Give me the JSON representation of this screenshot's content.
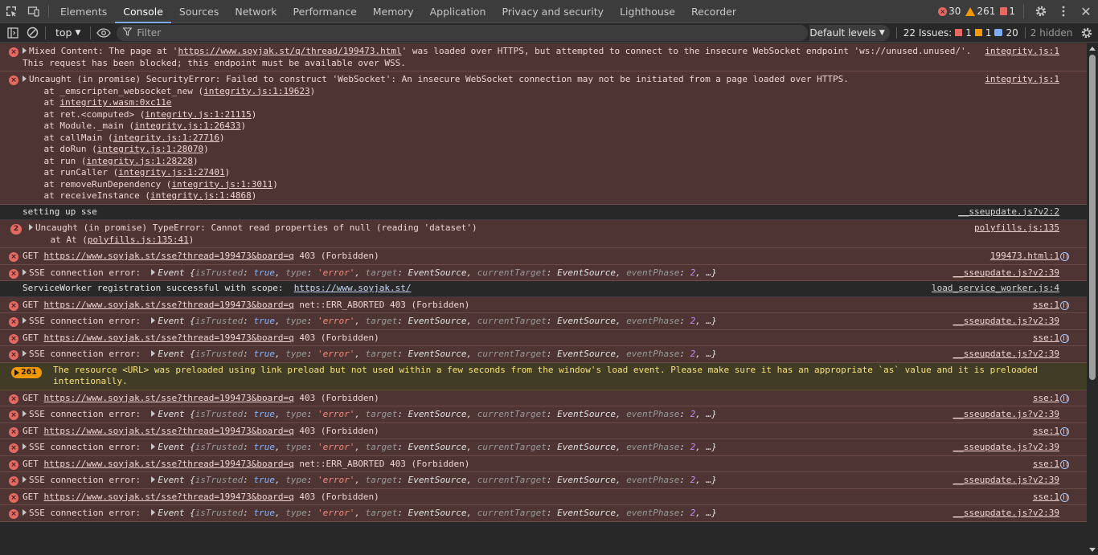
{
  "tabs": [
    "Elements",
    "Console",
    "Sources",
    "Network",
    "Performance",
    "Memory",
    "Application",
    "Privacy and security",
    "Lighthouse",
    "Recorder"
  ],
  "active_tab": "Console",
  "counts": {
    "errors": "30",
    "warnings": "261",
    "issues": "1"
  },
  "toolbar": {
    "context": "top",
    "filter_placeholder": "Filter",
    "levels": "Default levels",
    "issues_label": "22 Issues:",
    "issue_err": "1",
    "issue_warn": "1",
    "issue_info": "20",
    "hidden": "2 hidden"
  },
  "messages": [
    {
      "kind": "err",
      "ico": "x",
      "expand": true,
      "lines": [
        "Mixed Content: The page at 'https://www.soyjak.st/q/thread/199473.html' was loaded over HTTPS, but attempted to connect to the insecure WebSocket endpoint 'ws://unused.unused/'.",
        "This request has been blocked; this endpoint must be available over WSS."
      ],
      "src": "integrity.js:1"
    },
    {
      "kind": "err",
      "ico": "x",
      "expand": true,
      "lines": [
        "Uncaught (in promise) SecurityError: Failed to construct 'WebSocket': An insecure WebSocket connection may not be initiated from a page loaded over HTTPS.",
        "    at _emscripten_websocket_new (integrity.js:1:19623)",
        "    at integrity.wasm:0xc11e",
        "    at ret.<computed> (integrity.js:1:21115)",
        "    at Module._main (integrity.js:1:26433)",
        "    at callMain (integrity.js:1:27716)",
        "    at doRun (integrity.js:1:28070)",
        "    at run (integrity.js:1:28228)",
        "    at runCaller (integrity.js:1:27401)",
        "    at removeRunDependency (integrity.js:1:3011)",
        "    at receiveInstance (integrity.js:1:4868)"
      ],
      "src": "integrity.js:1"
    },
    {
      "kind": "info",
      "lines": [
        "setting up sse"
      ],
      "src": "__sseupdate.js?v2:2"
    },
    {
      "kind": "err",
      "badge": "2",
      "expand": true,
      "lines": [
        "Uncaught (in promise) TypeError: Cannot read properties of null (reading 'dataset')",
        "    at At (polyfills.js:135:41)"
      ],
      "src": "polyfills.js:135"
    },
    {
      "kind": "err",
      "ico": "x",
      "lines": [
        "GET https://www.soyjak.st/sse?thread=199473&board=q 403 (Forbidden)"
      ],
      "src": "199473.html:1",
      "net": true
    },
    {
      "kind": "err",
      "ico": "x",
      "expand": true,
      "event": true,
      "lines": [
        "SSE connection error:  "
      ],
      "src": "__sseupdate.js?v2:39"
    },
    {
      "kind": "info",
      "lines": [
        "ServiceWorker registration successful with scope:  https://www.soyjak.st/"
      ],
      "src": "load_service_worker.js:4"
    },
    {
      "kind": "err",
      "ico": "x",
      "lines": [
        "GET https://www.soyjak.st/sse?thread=199473&board=q net::ERR_ABORTED 403 (Forbidden)"
      ],
      "src": "sse:1",
      "net": true
    },
    {
      "kind": "err",
      "ico": "x",
      "expand": true,
      "event": true,
      "lines": [
        "SSE connection error:  "
      ],
      "src": "__sseupdate.js?v2:39"
    },
    {
      "kind": "err",
      "ico": "x",
      "lines": [
        "GET https://www.soyjak.st/sse?thread=199473&board=q 403 (Forbidden)"
      ],
      "src": "sse:1",
      "net": true
    },
    {
      "kind": "err",
      "ico": "x",
      "expand": true,
      "event": true,
      "lines": [
        "SSE connection error:  "
      ],
      "src": "__sseupdate.js?v2:39"
    },
    {
      "kind": "warn",
      "wbadge": "261",
      "lines": [
        "The resource <URL> was preloaded using link preload but not used within a few seconds from the window's load event. Please make sure it has an appropriate `as` value and it is preloaded",
        "intentionally."
      ]
    },
    {
      "kind": "err",
      "ico": "x",
      "lines": [
        "GET https://www.soyjak.st/sse?thread=199473&board=q 403 (Forbidden)"
      ],
      "src": "sse:1",
      "net": true
    },
    {
      "kind": "err",
      "ico": "x",
      "expand": true,
      "event": true,
      "lines": [
        "SSE connection error:  "
      ],
      "src": "__sseupdate.js?v2:39"
    },
    {
      "kind": "err",
      "ico": "x",
      "lines": [
        "GET https://www.soyjak.st/sse?thread=199473&board=q 403 (Forbidden)"
      ],
      "src": "sse:1",
      "net": true
    },
    {
      "kind": "err",
      "ico": "x",
      "expand": true,
      "event": true,
      "lines": [
        "SSE connection error:  "
      ],
      "src": "__sseupdate.js?v2:39"
    },
    {
      "kind": "err",
      "ico": "x",
      "lines": [
        "GET https://www.soyjak.st/sse?thread=199473&board=q net::ERR_ABORTED 403 (Forbidden)"
      ],
      "src": "sse:1",
      "net": true
    },
    {
      "kind": "err",
      "ico": "x",
      "expand": true,
      "event": true,
      "lines": [
        "SSE connection error:  "
      ],
      "src": "__sseupdate.js?v2:39"
    },
    {
      "kind": "err",
      "ico": "x",
      "lines": [
        "GET https://www.soyjak.st/sse?thread=199473&board=q 403 (Forbidden)"
      ],
      "src": "sse:1",
      "net": true
    },
    {
      "kind": "err",
      "ico": "x",
      "expand": true,
      "event": true,
      "lines": [
        "SSE connection error:  "
      ],
      "src": "__sseupdate.js?v2:39"
    }
  ],
  "event_text": "Event {isTrusted: true, type: 'error', target: EventSource, currentTarget: EventSource, eventPhase: 2, …}"
}
